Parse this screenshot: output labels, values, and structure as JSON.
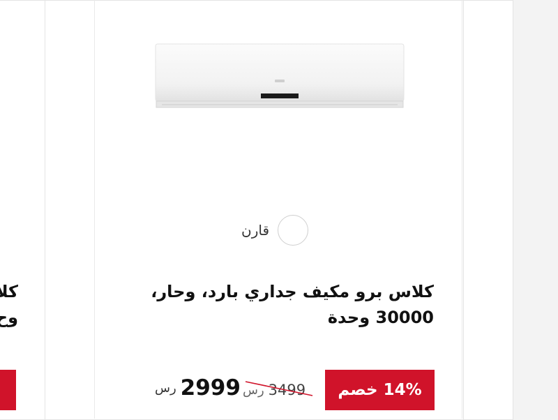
{
  "neighbour_left": {
    "title_fragment_line1": "كلا",
    "title_fragment_line2": "وح"
  },
  "product": {
    "compare_label": "قارن",
    "title": "كلاس برو مكيف جداري بارد، وحار، 30000 وحدة",
    "discount_badge": "14% خصم",
    "old_price": "3499",
    "old_price_currency": "رس",
    "price": "2999",
    "price_currency": "رس",
    "image_alt": "Class Pro wall split air conditioner"
  },
  "colors": {
    "accent": "#d0132a",
    "background": "#f3f3f3",
    "card": "#ffffff"
  }
}
